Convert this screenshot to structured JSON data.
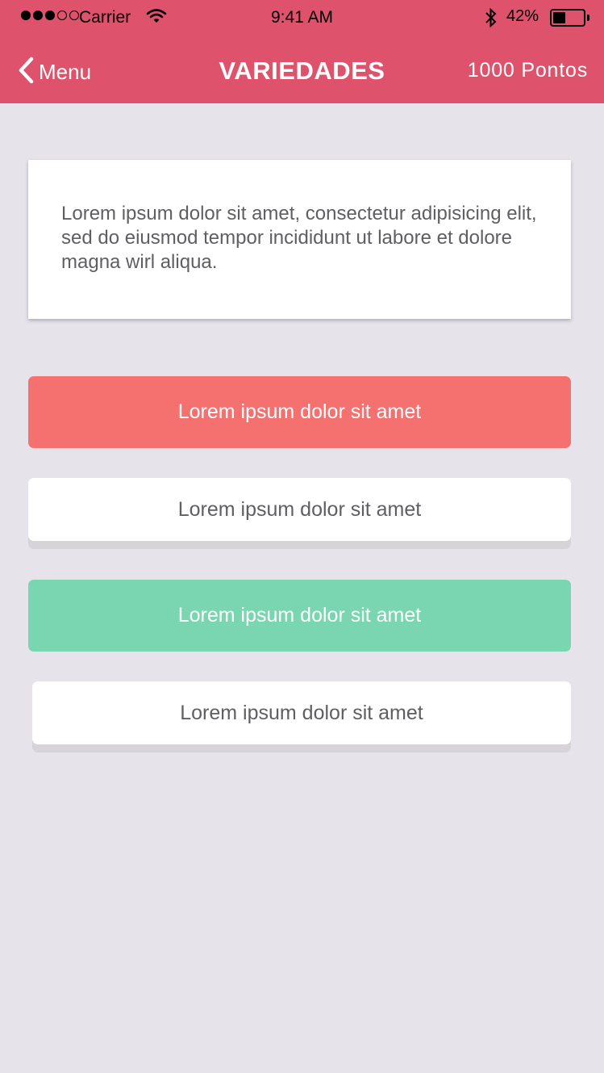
{
  "status_bar": {
    "carrier": "Carrier",
    "time": "9:41 AM",
    "battery_percent": "42%",
    "battery_level": 0.42
  },
  "nav": {
    "back_label": "Menu",
    "title": "VARIEDADES",
    "points": "1000 Pontos"
  },
  "card": {
    "text": "Lorem ipsum dolor sit amet, consectetur adipisicing elit, sed do eiusmod tempor incididunt ut labore et dolore magna wirl aliqua."
  },
  "options": [
    {
      "label": "Lorem ipsum dolor sit amet",
      "color": "#f47170"
    },
    {
      "label": "Lorem ipsum dolor sit amet",
      "color": "#ffffff"
    },
    {
      "label": "Lorem ipsum dolor sit amet",
      "color": "#79d6b0"
    },
    {
      "label": "Lorem ipsum dolor sit amet",
      "color": "#ffffff"
    }
  ],
  "colors": {
    "header": "#de526b",
    "background": "#e6e3ea",
    "text": "#5f5f63"
  }
}
